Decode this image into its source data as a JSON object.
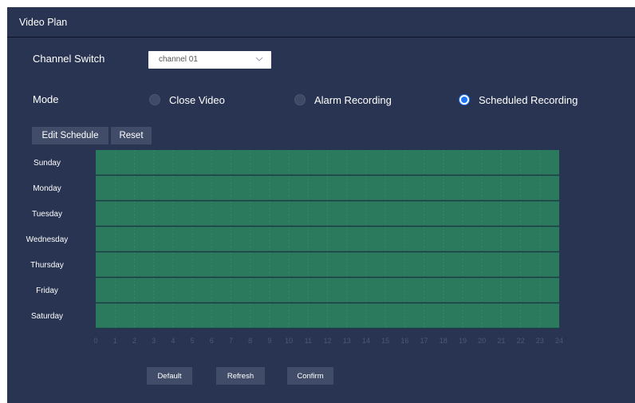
{
  "header": {
    "title": "Video Plan"
  },
  "channel": {
    "label": "Channel Switch",
    "value": "channel 01",
    "icon": "chevron-down-icon"
  },
  "mode": {
    "label": "Mode",
    "options": [
      {
        "label": "Close Video",
        "selected": false
      },
      {
        "label": "Alarm Recording",
        "selected": false
      },
      {
        "label": "Scheduled Recording",
        "selected": true
      }
    ]
  },
  "toolbar": {
    "edit_label": "Edit Schedule",
    "reset_label": "Reset"
  },
  "schedule": {
    "days": [
      "Sunday",
      "Monday",
      "Tuesday",
      "Wednesday",
      "Thursday",
      "Friday",
      "Saturday"
    ],
    "hours": [
      "0",
      "1",
      "2",
      "3",
      "4",
      "5",
      "6",
      "7",
      "8",
      "9",
      "10",
      "11",
      "12",
      "13",
      "14",
      "15",
      "16",
      "17",
      "18",
      "19",
      "20",
      "21",
      "22",
      "23",
      "24"
    ],
    "recording_color": "#2b7a5e",
    "coverage": "all days, 0-24"
  },
  "footer": {
    "default_label": "Default",
    "refresh_label": "Refresh",
    "confirm_label": "Confirm"
  },
  "colors": {
    "panel_bg": "#293452",
    "accent": "#1e73f5",
    "button_bg": "#414c68"
  }
}
